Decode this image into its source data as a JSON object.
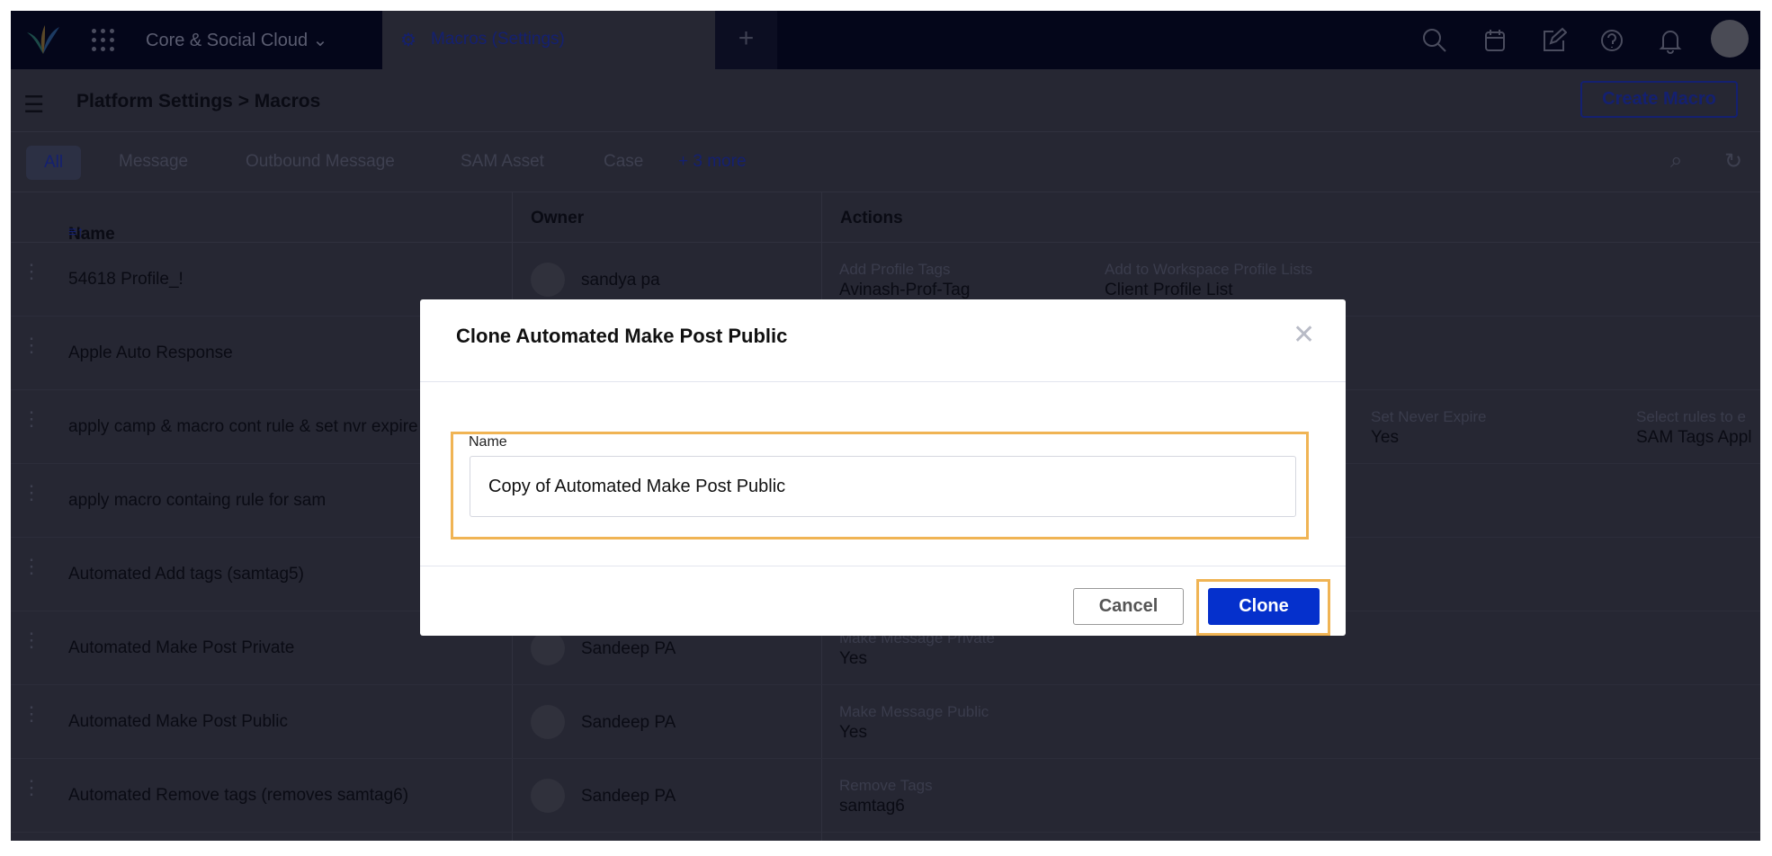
{
  "nav": {
    "app_switcher": "Core & Social Cloud",
    "active_tab": "Macros (Settings)",
    "new_tab": "+",
    "icons": [
      "search-icon",
      "calendar-icon",
      "compose-icon",
      "help-icon",
      "bell-icon",
      "avatar"
    ]
  },
  "header": {
    "breadcrumb": "Platform Settings > Macros",
    "create_button": "Create Macro"
  },
  "filters": {
    "items": [
      "All",
      "Message",
      "Outbound Message",
      "SAM Asset",
      "Case"
    ],
    "more": "+ 3 more"
  },
  "table": {
    "columns": [
      "Name",
      "Owner",
      "Actions"
    ],
    "rows": [
      {
        "name": "54618 Profile_!",
        "owner": "sandya pa",
        "actions": [
          {
            "label": "Add Profile Tags",
            "value": "Avinash-Prof-Tag"
          },
          {
            "label": "Add to Workspace Profile Lists",
            "value": "Client Profile List"
          }
        ]
      },
      {
        "name": "Apple Auto Response",
        "owner": "",
        "actions": []
      },
      {
        "name": "apply camp & macro cont rule & set nvr expire",
        "owner": "",
        "actions": [
          {
            "label": "",
            "value": ""
          },
          {
            "label": "",
            "value": ""
          },
          {
            "label": "Set Never Expire",
            "value": "Yes"
          },
          {
            "label": "Select rules to e",
            "value": "SAM Tags Appl"
          }
        ]
      },
      {
        "name": "apply macro containg rule for sam",
        "owner": "",
        "actions": []
      },
      {
        "name": "Automated Add tags (samtag5)",
        "owner": "",
        "actions": []
      },
      {
        "name": "Automated Make Post Private",
        "owner": "Sandeep PA",
        "actions": [
          {
            "label": "Make Message Private",
            "value": "Yes"
          }
        ]
      },
      {
        "name": "Automated Make Post Public",
        "owner": "Sandeep PA",
        "actions": [
          {
            "label": "Make Message Public",
            "value": "Yes"
          }
        ]
      },
      {
        "name": "Automated Remove tags (removes samtag6)",
        "owner": "Sandeep PA",
        "actions": [
          {
            "label": "Remove Tags",
            "value": "samtag6"
          }
        ]
      }
    ]
  },
  "modal": {
    "title": "Clone Automated Make Post Public",
    "field_label": "Name",
    "field_value": "Copy of Automated Make Post Public",
    "cancel": "Cancel",
    "clone": "Clone",
    "highlight_color": "#f0b454",
    "primary_color": "#0530cc"
  }
}
